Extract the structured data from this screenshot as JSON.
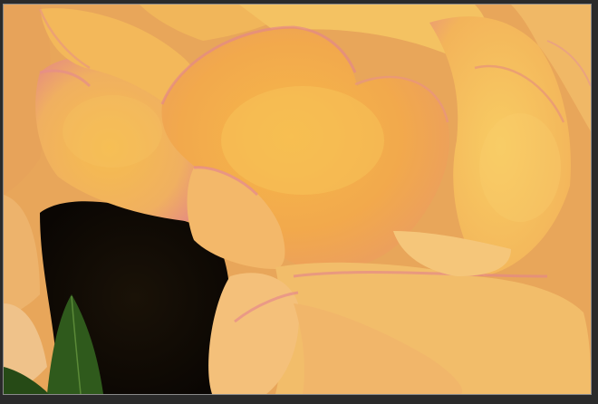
{
  "image": {
    "subject": "yellow-peach-begonia-flower-macro",
    "colors": {
      "frame": "#2a2a2a",
      "border": "#8a8a8a",
      "petal_light": "#f7c45a",
      "petal_mid": "#f1a94a",
      "petal_pink_edge": "#e68a8a",
      "shadow": "#120c06",
      "leaf": "#2f5a1c"
    }
  }
}
